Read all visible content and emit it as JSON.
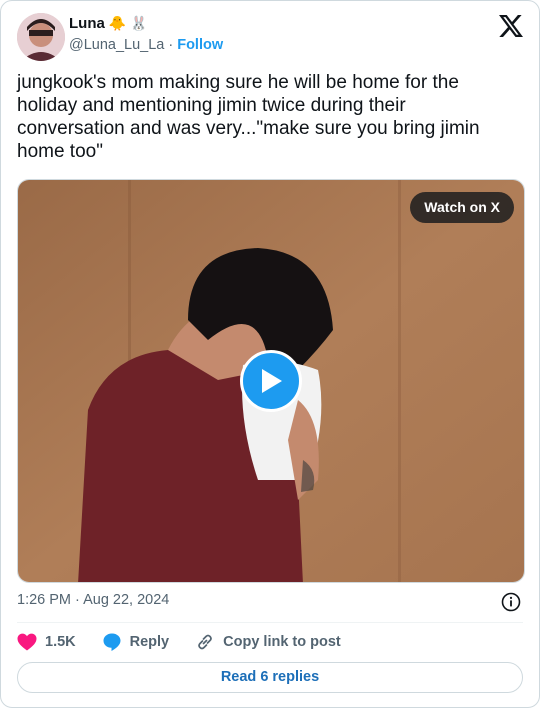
{
  "author": {
    "display_name": "Luna",
    "name_emojis": [
      "🐥",
      "🐰"
    ],
    "handle": "@Luna_Lu_La",
    "separator": "·",
    "follow_label": "Follow"
  },
  "platform_logo": "x-logo-icon",
  "tweet": {
    "text": "jungkook's mom making sure he will be home for the holiday and mentioning jimin twice during their conversation and was very...\"make sure you bring jimin home too\""
  },
  "media": {
    "watch_label": "Watch on X",
    "play_icon": "play-icon"
  },
  "meta": {
    "timestamp": "1:26 PM · Aug 22, 2024",
    "info_icon": "info-icon"
  },
  "actions": {
    "like_count": "1.5K",
    "reply_label": "Reply",
    "copy_label": "Copy link to post"
  },
  "read_replies_label": "Read 6 replies",
  "colors": {
    "accent": "#1d9bf0",
    "like": "#f91880",
    "text": "#0f1419",
    "muted": "#536471"
  }
}
